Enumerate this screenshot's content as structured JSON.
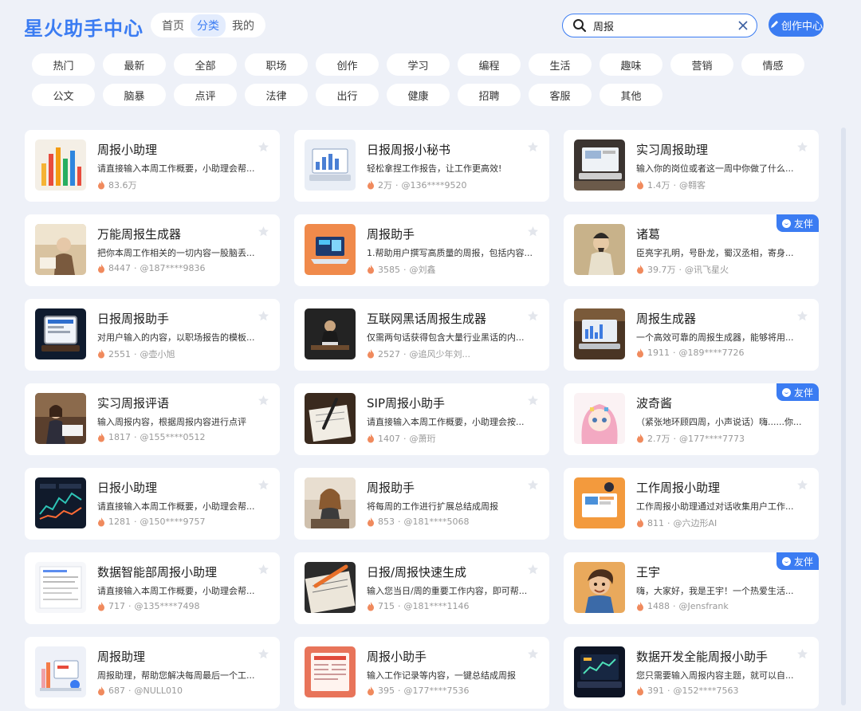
{
  "header": {
    "logo": "星火助手中心",
    "nav": [
      {
        "label": "首页",
        "active": false
      },
      {
        "label": "分类",
        "active": true
      },
      {
        "label": "我的",
        "active": false
      }
    ],
    "search_value": "周报",
    "create_label": "创作中心"
  },
  "categories": [
    "热门",
    "最新",
    "全部",
    "职场",
    "创作",
    "学习",
    "编程",
    "生活",
    "趣味",
    "营销",
    "情感",
    "公文",
    "脑暴",
    "点评",
    "法律",
    "出行",
    "健康",
    "招聘",
    "客服",
    "其他"
  ],
  "badge_label": "友伴",
  "cards": [
    {
      "title": "周报小助理",
      "desc": "请直接输入本周工作概要，小助理会帮...",
      "count": "83.6万",
      "author": "",
      "badge": false,
      "thumb": "chart-bars"
    },
    {
      "title": "日报周报小秘书",
      "desc": "轻松拿捏工作报告，让工作更高效!",
      "count": "2万",
      "author": "@136****9520",
      "badge": false,
      "thumb": "laptop-chart"
    },
    {
      "title": "实习周报助理",
      "desc": "输入你的岗位或者这一周中你做了什么...",
      "count": "1.4万",
      "author": "@翱客",
      "badge": false,
      "thumb": "laptop-desk"
    },
    {
      "title": "万能周报生成器",
      "desc": "把你本周工作相关的一切内容一股脑丢...",
      "count": "8447",
      "author": "@187****9836",
      "badge": false,
      "thumb": "old-man"
    },
    {
      "title": "周报助手",
      "desc": "1.帮助用户撰写高质量的周报，包括内容...",
      "count": "3585",
      "author": "@刘鑫",
      "badge": false,
      "thumb": "orange-laptop"
    },
    {
      "title": "诸葛",
      "desc": "臣亮字孔明，号卧龙，蜀汉丞相，寄身...",
      "count": "39.7万",
      "author": "@讯飞星火",
      "badge": true,
      "thumb": "zhuge"
    },
    {
      "title": "日报周报助手",
      "desc": "对用户输入的内容，以职场报告的模板...",
      "count": "2551",
      "author": "@壶小旭",
      "badge": false,
      "thumb": "tablet"
    },
    {
      "title": "互联网黑话周报生成器",
      "desc": "仅需两句话获得包含大量行业黑话的内...",
      "count": "2527",
      "author": "@追风少年刘...",
      "badge": false,
      "thumb": "dark-man"
    },
    {
      "title": "周报生成器",
      "desc": "一个高效可靠的周报生成器，能够将用...",
      "count": "1911",
      "author": "@189****7726",
      "badge": false,
      "thumb": "laptop-library"
    },
    {
      "title": "实习周报评语",
      "desc": "输入周报内容，根据周报内容进行点评",
      "count": "1817",
      "author": "@155****0512",
      "badge": false,
      "thumb": "woman-desk"
    },
    {
      "title": "SIP周报小助手",
      "desc": "请直接输入本周工作概要，小助理会按...",
      "count": "1407",
      "author": "@萧珩",
      "badge": false,
      "thumb": "pen-paper"
    },
    {
      "title": "波奇酱",
      "desc": "（紧张地环顾四周，小声说话）嗨......你...",
      "count": "2.7万",
      "author": "@177****7773",
      "badge": true,
      "thumb": "anime-girl"
    },
    {
      "title": "日报小助理",
      "desc": "请直接输入本周工作概要，小助理会帮...",
      "count": "1281",
      "author": "@150****9757",
      "badge": false,
      "thumb": "dark-dashboard"
    },
    {
      "title": "周报助手",
      "desc": "将每周的工作进行扩展总结成周报",
      "count": "853",
      "author": "@181****5068",
      "badge": false,
      "thumb": "woman-glasses"
    },
    {
      "title": "工作周报小助理",
      "desc": "工作周报小助理通过对话收集用户工作...",
      "count": "811",
      "author": "@六边形AI",
      "badge": false,
      "thumb": "orange-office"
    },
    {
      "title": "数据智能部周报小助理",
      "desc": "请直接输入本周工作概要，小助理会帮...",
      "count": "717",
      "author": "@135****7498",
      "badge": false,
      "thumb": "document"
    },
    {
      "title": "日报/周报快速生成",
      "desc": "输入您当日/周的重要工作内容，即可帮...",
      "count": "715",
      "author": "@181****1146",
      "badge": false,
      "thumb": "pen-notes"
    },
    {
      "title": "王宇",
      "desc": "嗨，大家好，我是王宇！一个热爱生活...",
      "count": "1488",
      "author": "@Jensfrank",
      "badge": true,
      "thumb": "cartoon-man"
    },
    {
      "title": "周报助理",
      "desc": "周报助理，帮助您解决每周最后一个工...",
      "count": "687",
      "author": "@NULL010",
      "badge": false,
      "thumb": "illustration"
    },
    {
      "title": "周报小助手",
      "desc": "输入工作记录等内容，一键总结成周报",
      "count": "395",
      "author": "@177****7536",
      "badge": false,
      "thumb": "red-doc"
    },
    {
      "title": "数据开发全能周报小助手",
      "desc": "您只需要输入周报内容主题，就可以自...",
      "count": "391",
      "author": "@152****7563",
      "badge": false,
      "thumb": "laptop-data"
    }
  ],
  "colors": {
    "accent": "#3b7cf2",
    "background": "#eef1f8",
    "flame": "#f08a5d"
  }
}
